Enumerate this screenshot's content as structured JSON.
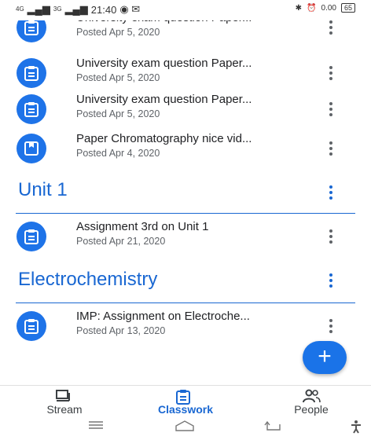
{
  "status": {
    "time": "21:40",
    "net1": "4G",
    "net2": "3G",
    "speed": "0.00",
    "battery": "65"
  },
  "items_top": [
    {
      "title": "University exam question Paper...",
      "date": "Posted Apr 5, 2020",
      "icon": "assignment-icon"
    },
    {
      "title": "University exam question Paper...",
      "date": "Posted Apr 5, 2020",
      "icon": "assignment-icon"
    },
    {
      "title": "University exam question Paper...",
      "date": "Posted Apr 5, 2020",
      "icon": "assignment-icon"
    },
    {
      "title": "Paper Chromatography nice vid...",
      "date": "Posted Apr 4, 2020",
      "icon": "material-icon"
    }
  ],
  "topics": [
    {
      "name": "Unit 1",
      "items": [
        {
          "title": "Assignment 3rd on Unit 1",
          "date": "Posted Apr 21, 2020",
          "icon": "assignment-icon"
        }
      ]
    },
    {
      "name": "Electrochemistry",
      "items": [
        {
          "title": "IMP: Assignment on Electroche...",
          "date": "Posted Apr 13, 2020",
          "icon": "assignment-icon"
        }
      ]
    }
  ],
  "fab": {
    "label": "+"
  },
  "bottom_nav": [
    {
      "label": "Stream",
      "icon": "stream-icon",
      "active": false
    },
    {
      "label": "Classwork",
      "icon": "classwork-icon",
      "active": true
    },
    {
      "label": "People",
      "icon": "people-icon",
      "active": false
    }
  ],
  "colors": {
    "accent": "#1967d2",
    "icon_bg": "#1e73e8",
    "text": "#202124",
    "muted": "#5f6368"
  }
}
